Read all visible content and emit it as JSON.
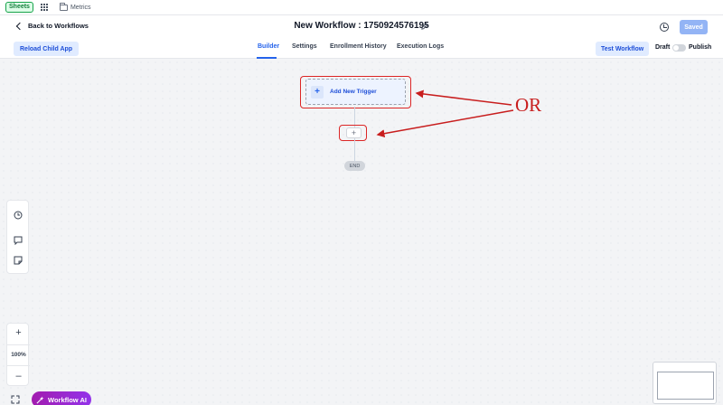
{
  "topbar": {
    "sheets_badge": "Sheets",
    "breadcrumb_folder": "Metrics"
  },
  "header": {
    "back_label": "Back to Workflows",
    "workflow_title": "New Workflow : 1750924576195",
    "saved_label": "Saved"
  },
  "tabsbar": {
    "reload_label": "Reload Child App",
    "tabs": [
      {
        "label": "Builder",
        "active": true
      },
      {
        "label": "Settings",
        "active": false
      },
      {
        "label": "Enrollment History",
        "active": false
      },
      {
        "label": "Execution Logs",
        "active": false
      }
    ],
    "test_label": "Test Workflow",
    "draft_label": "Draft",
    "publish_label": "Publish",
    "publish_toggle_on": false
  },
  "canvas": {
    "trigger_label": "Add New Trigger",
    "add_node_symbol": "+",
    "end_label": "END",
    "annotation_text": "OR",
    "annotation_color": "#c81e1e"
  },
  "tools": {
    "zoom_in": "+",
    "zoom_level": "100%",
    "zoom_out": "–"
  },
  "ai": {
    "label": "Workflow AI"
  },
  "colors": {
    "accent": "#2563eb",
    "saved_button": "#93b4f5",
    "ai_gradient_start": "#a21caf",
    "ai_gradient_end": "#9333ea"
  }
}
